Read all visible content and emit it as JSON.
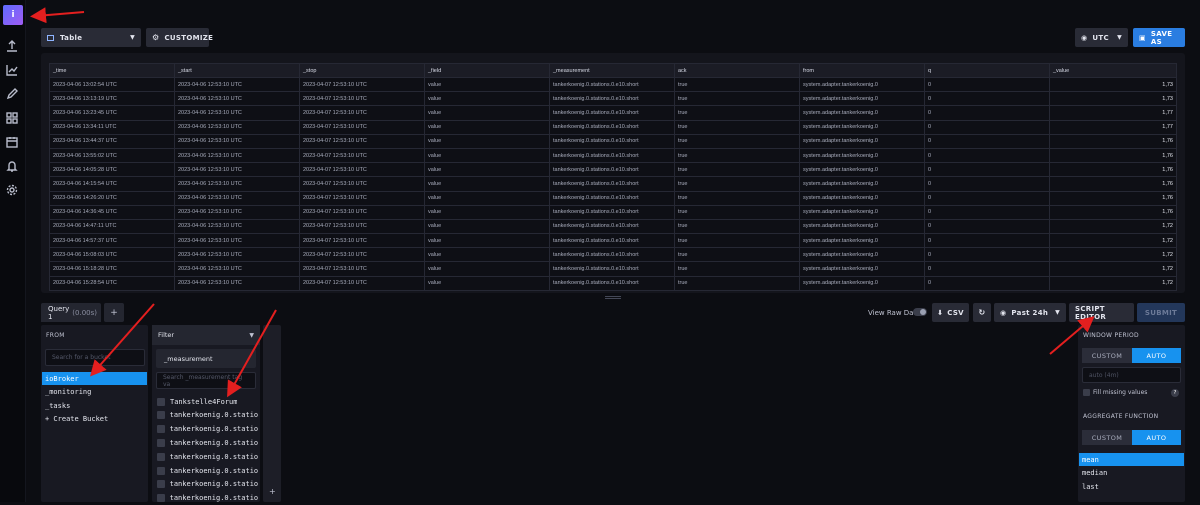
{
  "nav": {
    "logo_letter": "i",
    "items": [
      "upload-icon",
      "graph-icon",
      "pencil-icon",
      "dashboard-icon",
      "calendar-icon",
      "bell-icon",
      "gear-icon"
    ]
  },
  "toolbar": {
    "view_type": "Table",
    "customize": "CUSTOMIZE",
    "timezone": "UTC",
    "save_as": "SAVE AS"
  },
  "table": {
    "columns": [
      "_time",
      "_start",
      "_stop",
      "_field",
      "_measurement",
      "ack",
      "from",
      "q",
      "_value"
    ],
    "rows": [
      [
        "2023-04-06 13:02:54 UTC",
        "2023-04-06 12:53:10 UTC",
        "2023-04-07 12:53:10 UTC",
        "value",
        "tankerkoenig.0.stations.0.e10.short",
        "true",
        "system.adapter.tankerkoenig.0",
        "0",
        "1,73"
      ],
      [
        "2023-04-06 13:13:19 UTC",
        "2023-04-06 12:53:10 UTC",
        "2023-04-07 12:53:10 UTC",
        "value",
        "tankerkoenig.0.stations.0.e10.short",
        "true",
        "system.adapter.tankerkoenig.0",
        "0",
        "1,73"
      ],
      [
        "2023-04-06 13:23:45 UTC",
        "2023-04-06 12:53:10 UTC",
        "2023-04-07 12:53:10 UTC",
        "value",
        "tankerkoenig.0.stations.0.e10.short",
        "true",
        "system.adapter.tankerkoenig.0",
        "0",
        "1,77"
      ],
      [
        "2023-04-06 13:34:11 UTC",
        "2023-04-06 12:53:10 UTC",
        "2023-04-07 12:53:10 UTC",
        "value",
        "tankerkoenig.0.stations.0.e10.short",
        "true",
        "system.adapter.tankerkoenig.0",
        "0",
        "1,77"
      ],
      [
        "2023-04-06 13:44:37 UTC",
        "2023-04-06 12:53:10 UTC",
        "2023-04-07 12:53:10 UTC",
        "value",
        "tankerkoenig.0.stations.0.e10.short",
        "true",
        "system.adapter.tankerkoenig.0",
        "0",
        "1,76"
      ],
      [
        "2023-04-06 13:55:02 UTC",
        "2023-04-06 12:53:10 UTC",
        "2023-04-07 12:53:10 UTC",
        "value",
        "tankerkoenig.0.stations.0.e10.short",
        "true",
        "system.adapter.tankerkoenig.0",
        "0",
        "1,76"
      ],
      [
        "2023-04-06 14:05:28 UTC",
        "2023-04-06 12:53:10 UTC",
        "2023-04-07 12:53:10 UTC",
        "value",
        "tankerkoenig.0.stations.0.e10.short",
        "true",
        "system.adapter.tankerkoenig.0",
        "0",
        "1,76"
      ],
      [
        "2023-04-06 14:15:54 UTC",
        "2023-04-06 12:53:10 UTC",
        "2023-04-07 12:53:10 UTC",
        "value",
        "tankerkoenig.0.stations.0.e10.short",
        "true",
        "system.adapter.tankerkoenig.0",
        "0",
        "1,76"
      ],
      [
        "2023-04-06 14:26:20 UTC",
        "2023-04-06 12:53:10 UTC",
        "2023-04-07 12:53:10 UTC",
        "value",
        "tankerkoenig.0.stations.0.e10.short",
        "true",
        "system.adapter.tankerkoenig.0",
        "0",
        "1,76"
      ],
      [
        "2023-04-06 14:36:45 UTC",
        "2023-04-06 12:53:10 UTC",
        "2023-04-07 12:53:10 UTC",
        "value",
        "tankerkoenig.0.stations.0.e10.short",
        "true",
        "system.adapter.tankerkoenig.0",
        "0",
        "1,76"
      ],
      [
        "2023-04-06 14:47:11 UTC",
        "2023-04-06 12:53:10 UTC",
        "2023-04-07 12:53:10 UTC",
        "value",
        "tankerkoenig.0.stations.0.e10.short",
        "true",
        "system.adapter.tankerkoenig.0",
        "0",
        "1,72"
      ],
      [
        "2023-04-06 14:57:37 UTC",
        "2023-04-06 12:53:10 UTC",
        "2023-04-07 12:53:10 UTC",
        "value",
        "tankerkoenig.0.stations.0.e10.short",
        "true",
        "system.adapter.tankerkoenig.0",
        "0",
        "1,72"
      ],
      [
        "2023-04-06 15:08:03 UTC",
        "2023-04-06 12:53:10 UTC",
        "2023-04-07 12:53:10 UTC",
        "value",
        "tankerkoenig.0.stations.0.e10.short",
        "true",
        "system.adapter.tankerkoenig.0",
        "0",
        "1,72"
      ],
      [
        "2023-04-06 15:18:28 UTC",
        "2023-04-06 12:53:10 UTC",
        "2023-04-07 12:53:10 UTC",
        "value",
        "tankerkoenig.0.stations.0.e10.short",
        "true",
        "system.adapter.tankerkoenig.0",
        "0",
        "1,72"
      ],
      [
        "2023-04-06 15:28:54 UTC",
        "2023-04-06 12:53:10 UTC",
        "2023-04-07 12:53:10 UTC",
        "value",
        "tankerkoenig.0.stations.0.e10.short",
        "true",
        "system.adapter.tankerkoenig.0",
        "0",
        "1,72"
      ]
    ]
  },
  "query": {
    "tab_label": "Query 1",
    "tab_time": "(0.00s)",
    "add_tab": "+",
    "view_raw": "View Raw Data",
    "csv": "CSV",
    "time_range": "Past 24h",
    "script_editor": "SCRIPT EDITOR",
    "submit": "SUBMIT"
  },
  "from_panel": {
    "title": "FROM",
    "search_placeholder": "Search for a bucket",
    "buckets": [
      "ioBroker",
      "_monitoring",
      "_tasks",
      "+ Create Bucket"
    ]
  },
  "filter_panel": {
    "title": "Filter",
    "key": "_measurement",
    "search_placeholder": "Search _measurement tag va",
    "values": [
      "Tankstelle4Forum",
      "tankerkoenig.0.station",
      "tankerkoenig.0.station",
      "tankerkoenig.0.station",
      "tankerkoenig.0.station",
      "tankerkoenig.0.station",
      "tankerkoenig.0.station",
      "tankerkoenig.0.station"
    ],
    "add": "+"
  },
  "aggregate": {
    "window_title": "WINDOW PERIOD",
    "custom": "CUSTOM",
    "auto": "AUTO",
    "auto_hint": "auto (4m)",
    "fill_missing": "Fill missing values",
    "help": "?",
    "function_title": "AGGREGATE FUNCTION",
    "functions": [
      "mean",
      "median",
      "last"
    ]
  },
  "colors": {
    "accent": "#1792ef",
    "blue_button": "#2a7de1",
    "arrow": "#e41f1f"
  }
}
